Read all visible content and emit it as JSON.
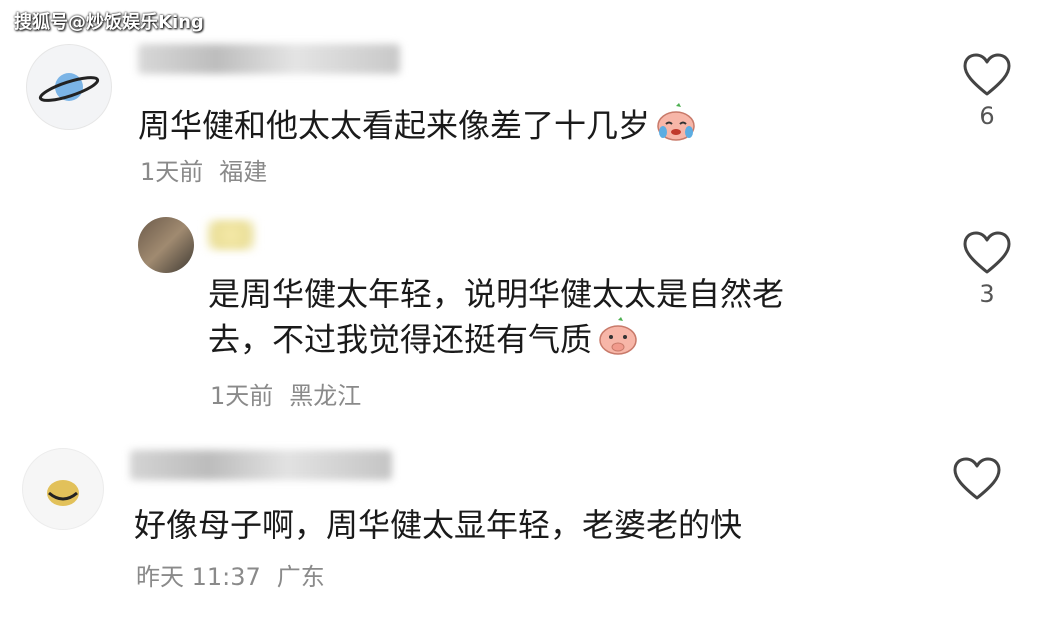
{
  "watermark": "搜狐号@炒饭娱乐King",
  "comments": [
    {
      "text": "周华健和他太太看起来像差了十几岁",
      "time": "1天前",
      "location": "福建",
      "likes": "6",
      "emoji": "crying-face-icon"
    },
    {
      "line1": "是周华健太年轻，说明华健太太是自然老",
      "line2": "去，不过我觉得还挺有气质",
      "time": "1天前",
      "location": "黑龙江",
      "likes": "3",
      "emoji": "shy-face-icon"
    },
    {
      "text": "好像母子啊，周华健太显年轻，老婆老的快",
      "time": "昨天 11:37",
      "location": "广东",
      "likes": ""
    }
  ],
  "colors": {
    "text": "#1a1a1a",
    "meta": "#8a8a8a",
    "icon": "#444444"
  }
}
